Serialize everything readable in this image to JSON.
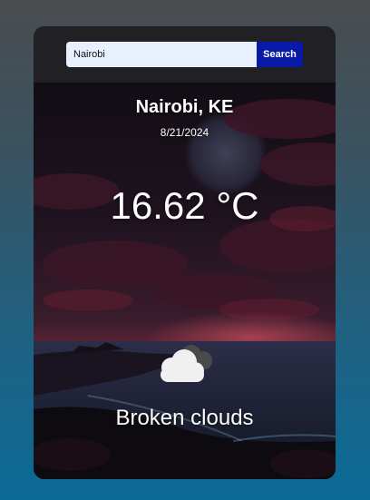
{
  "search": {
    "value": "Nairobi",
    "button_label": "Search"
  },
  "weather": {
    "location": "Nairobi, KE",
    "date": "8/21/2024",
    "temperature": "16.62 °C",
    "description": "Broken clouds",
    "icon": "broken-clouds-icon"
  }
}
